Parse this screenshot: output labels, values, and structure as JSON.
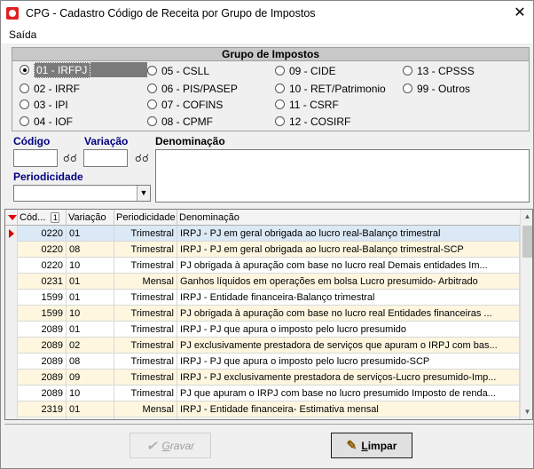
{
  "window": {
    "title": "CPG - Cadastro Código de Receita por Grupo de Impostos",
    "close_glyph": "✕"
  },
  "menu": {
    "items": [
      "Saída"
    ]
  },
  "group": {
    "title": "Grupo de Impostos",
    "options": [
      {
        "label": "01 - IRFPJ",
        "selected": true
      },
      {
        "label": "02 - IRRF",
        "selected": false
      },
      {
        "label": "03 - IPI",
        "selected": false
      },
      {
        "label": "04 - IOF",
        "selected": false
      },
      {
        "label": "05 - CSLL",
        "selected": false
      },
      {
        "label": "06 - PIS/PASEP",
        "selected": false
      },
      {
        "label": "07 - COFINS",
        "selected": false
      },
      {
        "label": "08 - CPMF",
        "selected": false
      },
      {
        "label": "09 - CIDE",
        "selected": false
      },
      {
        "label": "10 - RET/Patrimonio",
        "selected": false
      },
      {
        "label": "11 - CSRF",
        "selected": false
      },
      {
        "label": "12 - COSIRF",
        "selected": false
      },
      {
        "label": "13 - CPSSS",
        "selected": false
      },
      {
        "label": "99 - Outros",
        "selected": false
      }
    ]
  },
  "form": {
    "codigo_label": "Código",
    "variacao_label": "Variação",
    "denominacao_label": "Denominação",
    "periodicidade_label": "Periodicidade",
    "codigo_value": "",
    "variacao_value": "",
    "denominacao_value": "",
    "periodicidade_value": ""
  },
  "grid": {
    "columns": [
      "Cód...",
      "Variação",
      "Periodicidade",
      "Denominação"
    ],
    "sort_index": "1",
    "rows": [
      {
        "codigo": "0220",
        "variacao": "01",
        "periodicidade": "Trimestral",
        "denominacao": "IRPJ - PJ em geral obrigada ao lucro real-Balanço trimestral"
      },
      {
        "codigo": "0220",
        "variacao": "08",
        "periodicidade": "Trimestral",
        "denominacao": "IRPJ - PJ em geral obrigada ao lucro real-Balanço trimestral-SCP"
      },
      {
        "codigo": "0220",
        "variacao": "10",
        "periodicidade": "Trimestral",
        "denominacao": "PJ obrigada à apuração com base no lucro real  Demais entidades  Im..."
      },
      {
        "codigo": "0231",
        "variacao": "01",
        "periodicidade": "Mensal",
        "denominacao": "Ganhos líquidos em operações em bolsa  Lucro presumido- Arbitrado"
      },
      {
        "codigo": "1599",
        "variacao": "01",
        "periodicidade": "Trimestral",
        "denominacao": "IRPJ - Entidade financeira-Balanço trimestral"
      },
      {
        "codigo": "1599",
        "variacao": "10",
        "periodicidade": "Trimestral",
        "denominacao": "PJ obrigada à apuração com base no lucro real  Entidades financeiras ..."
      },
      {
        "codigo": "2089",
        "variacao": "01",
        "periodicidade": "Trimestral",
        "denominacao": "IRPJ - PJ que apura o imposto pelo lucro presumido"
      },
      {
        "codigo": "2089",
        "variacao": "02",
        "periodicidade": "Trimestral",
        "denominacao": "PJ exclusivamente prestadora de serviços que apuram o IRPJ com bas..."
      },
      {
        "codigo": "2089",
        "variacao": "08",
        "periodicidade": "Trimestral",
        "denominacao": "IRPJ - PJ que apura o imposto pelo lucro presumido-SCP"
      },
      {
        "codigo": "2089",
        "variacao": "09",
        "periodicidade": "Trimestral",
        "denominacao": "IRPJ - PJ exclusivamente prestadora de serviços-Lucro presumido-Imp..."
      },
      {
        "codigo": "2089",
        "variacao": "10",
        "periodicidade": "Trimestral",
        "denominacao": "PJ que apuram o IRPJ com base no lucro presumido  Imposto de renda..."
      },
      {
        "codigo": "2319",
        "variacao": "01",
        "periodicidade": "Mensal",
        "denominacao": "IRPJ - Entidade financeira- Estimativa mensal"
      },
      {
        "codigo": "",
        "variacao": "",
        "periodicidade": "",
        "denominacao": ""
      }
    ]
  },
  "buttons": {
    "gravar": {
      "label_first": "G",
      "label_rest": "ravar"
    },
    "limpar": {
      "label_first": "L",
      "label_rest": "impar"
    }
  }
}
